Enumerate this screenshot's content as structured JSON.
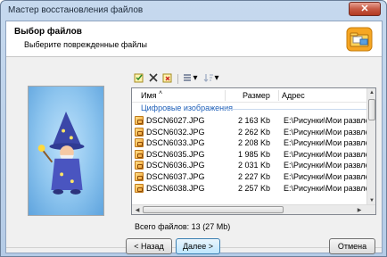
{
  "window": {
    "title": "Мастер восстановления файлов",
    "close_label": "✕"
  },
  "header": {
    "title": "Выбор файлов",
    "subtitle": "Выберите поврежденные файлы"
  },
  "icons": {
    "header": "folder-icon",
    "wizard": "wizard-icon",
    "toolbar": [
      "select-all-icon",
      "delete-icon",
      "uncheck-icon",
      "view-icon",
      "sort-icon"
    ]
  },
  "toolbar": {
    "view_dropdown": "▾",
    "sort_dropdown": "▾"
  },
  "table": {
    "columns": {
      "name": "Имя",
      "size": "Размер",
      "address": "Адрес"
    },
    "sort_indicator": "˄",
    "group": "Цифровые изображения",
    "rows": [
      {
        "name": "DSCN6027.JPG",
        "size": "2 163 Kb",
        "address": "E:\\Рисунки\\Мои развлече"
      },
      {
        "name": "DSCN6032.JPG",
        "size": "2 262 Kb",
        "address": "E:\\Рисунки\\Мои развлече"
      },
      {
        "name": "DSCN6033.JPG",
        "size": "2 208 Kb",
        "address": "E:\\Рисунки\\Мои развлече"
      },
      {
        "name": "DSCN6035.JPG",
        "size": "1 985 Kb",
        "address": "E:\\Рисунки\\Мои развлече"
      },
      {
        "name": "DSCN6036.JPG",
        "size": "2 031 Kb",
        "address": "E:\\Рисунки\\Мои развлече"
      },
      {
        "name": "DSCN6037.JPG",
        "size": "2 227 Kb",
        "address": "E:\\Рисунки\\Мои развлече"
      },
      {
        "name": "DSCN6038.JPG",
        "size": "2 257 Kb",
        "address": "E:\\Рисунки\\Мои развлече"
      }
    ]
  },
  "total": "Всего файлов: 13 (27 Mb)",
  "buttons": {
    "back": "< Назад",
    "next": "Далее >",
    "cancel": "Отмена"
  }
}
